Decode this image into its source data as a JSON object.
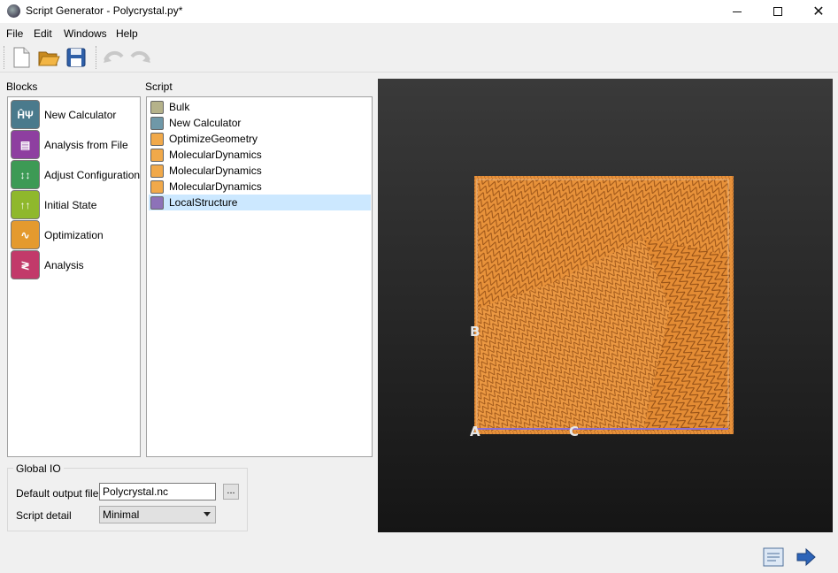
{
  "window": {
    "title": "Script Generator - Polycrystal.py*"
  },
  "menu": [
    "File",
    "Edit",
    "Windows",
    "Help"
  ],
  "toolbar": {
    "icons": [
      "new-file-icon",
      "open-folder-icon",
      "save-icon",
      "undo-icon",
      "redo-icon"
    ]
  },
  "blocks": {
    "header": "Blocks",
    "items": [
      {
        "label": "New Calculator",
        "icon": "calculator-icon",
        "color": "#4a7a8c",
        "glyph": "ĤΨ"
      },
      {
        "label": "Analysis from File",
        "icon": "analysis-file-icon",
        "color": "#8e3fa0",
        "glyph": "▤"
      },
      {
        "label": "Adjust Configuration",
        "icon": "adjust-config-icon",
        "color": "#3d9a55",
        "glyph": "↕↕"
      },
      {
        "label": "Initial State",
        "icon": "initial-state-icon",
        "color": "#8fb82c",
        "glyph": "↑↑"
      },
      {
        "label": "Optimization",
        "icon": "optimization-icon",
        "color": "#e49a2e",
        "glyph": "∿"
      },
      {
        "label": "Analysis",
        "icon": "analysis-icon",
        "color": "#c23a6a",
        "glyph": "≷"
      }
    ]
  },
  "script": {
    "header": "Script",
    "items": [
      {
        "label": "Bulk",
        "color": "#b5b28a",
        "selected": false
      },
      {
        "label": "New Calculator",
        "color": "#6f98a8",
        "selected": false
      },
      {
        "label": "OptimizeGeometry",
        "color": "#f1a94a",
        "selected": false
      },
      {
        "label": "MolecularDynamics",
        "color": "#f1a94a",
        "selected": false
      },
      {
        "label": "MolecularDynamics",
        "color": "#f1a94a",
        "selected": false
      },
      {
        "label": "MolecularDynamics",
        "color": "#f1a94a",
        "selected": false
      },
      {
        "label": "LocalStructure",
        "color": "#8d72b8",
        "selected": true
      }
    ]
  },
  "global_io": {
    "title": "Global IO",
    "output_label": "Default output file",
    "output_value": "Polycrystal.nc",
    "browse_label": "...",
    "detail_label": "Script detail",
    "detail_value": "Minimal"
  },
  "viewer": {
    "axis_labels": {
      "a": "A",
      "b": "B",
      "c": "C"
    },
    "structure_color": "#e8923a",
    "background_color": "#2a2a2a"
  },
  "footer": {
    "icons": [
      "script-view-icon",
      "send-to-icon"
    ]
  }
}
